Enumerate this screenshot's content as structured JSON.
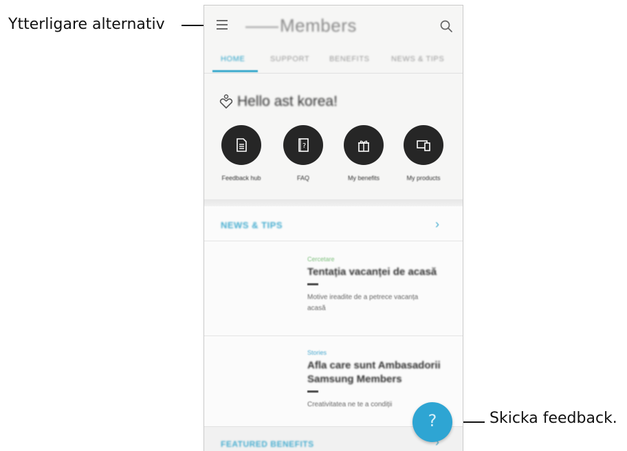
{
  "callouts": {
    "more_options": "Ytterligare alternativ",
    "send_feedback": "Skicka feedback."
  },
  "app": {
    "title": "Members",
    "tabs": [
      "HOME",
      "SUPPORT",
      "BENEFITS",
      "NEWS & TIPS"
    ],
    "greeting": "Hello ast korea!",
    "shortcuts": [
      {
        "label": "Feedback hub",
        "icon": "document-icon"
      },
      {
        "label": "FAQ",
        "icon": "help-book-icon"
      },
      {
        "label": "My benefits",
        "icon": "gift-icon"
      },
      {
        "label": "My products",
        "icon": "devices-icon"
      }
    ],
    "news_section": {
      "heading": "NEWS & TIPS",
      "items": [
        {
          "category": "Cercetare",
          "title": "Tentația vacanței de acasă",
          "description": "Motive ireadite de a petrece vacanța acasă"
        },
        {
          "category": "Stories",
          "title": "Afla care sunt Ambasadorii Samsung Members",
          "description": "Creativitatea ne te a condiții"
        }
      ]
    },
    "featured_heading": "FEATURED BENEFITS",
    "fab_symbol": "?"
  },
  "colors": {
    "accent": "#2ea5d3",
    "shortcut_circle": "#262626"
  }
}
